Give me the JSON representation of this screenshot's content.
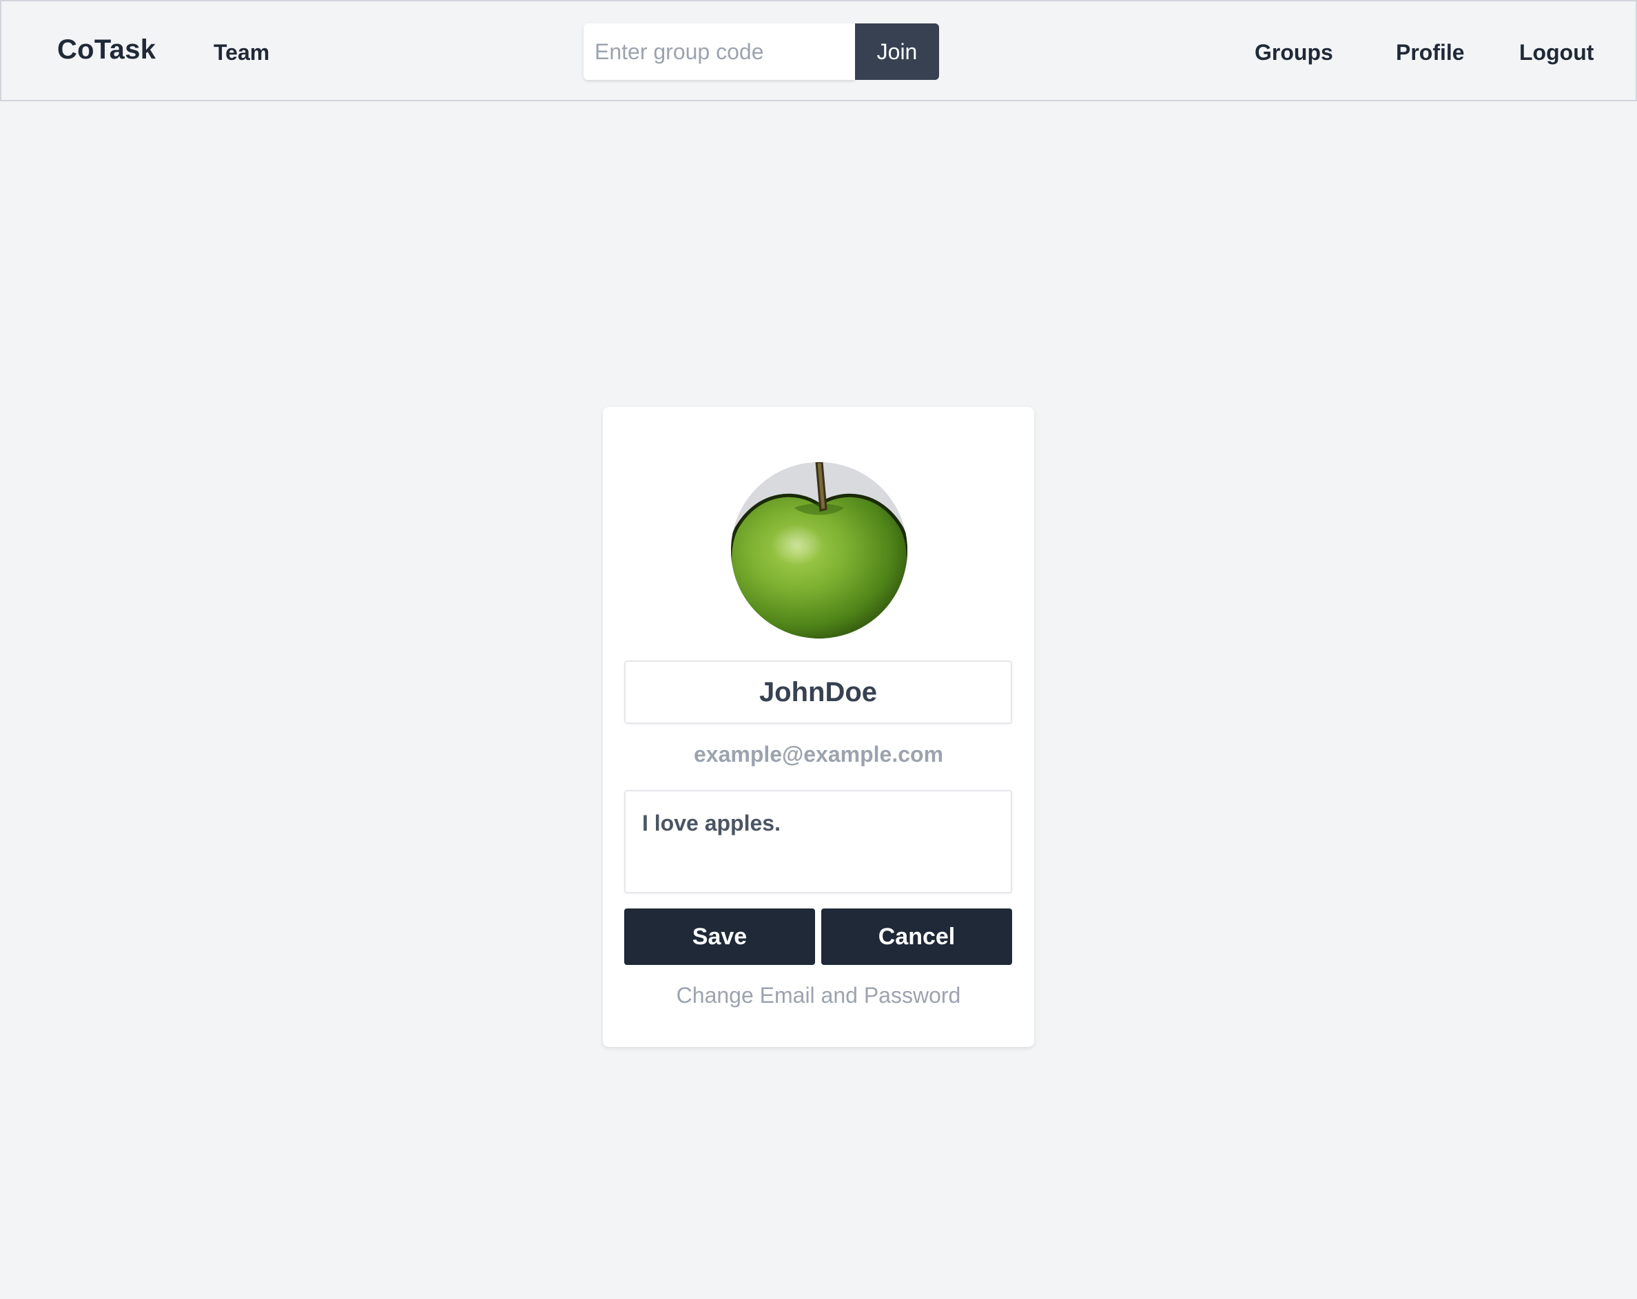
{
  "navbar": {
    "brand": "CoTask",
    "team_link": "Team",
    "group_code_placeholder": "Enter group code",
    "group_code_value": "",
    "join_label": "Join",
    "groups_link": "Groups",
    "profile_link": "Profile",
    "logout_link": "Logout"
  },
  "profile": {
    "avatar_icon": "green-apple-image",
    "username": "JohnDoe",
    "email": "example@example.com",
    "bio": "I love apples.",
    "save_label": "Save",
    "cancel_label": "Cancel",
    "change_credentials_link": "Change Email and Password"
  },
  "colors": {
    "page_background": "#f3f4f6",
    "button_dark": "#1f2937",
    "join_button": "#374151",
    "muted_text": "#9ca3af"
  }
}
